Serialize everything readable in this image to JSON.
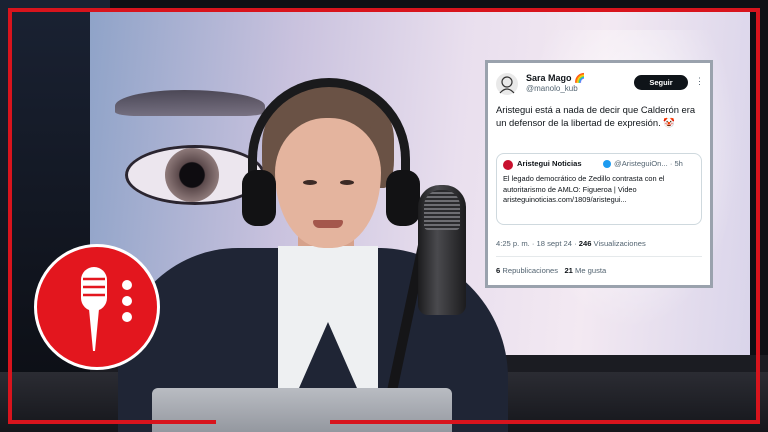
{
  "tweet": {
    "author_name": "Sara Mago 🌈",
    "author_handle": "@manolo_kub",
    "follow_label": "Seguir",
    "more_label": "⋮",
    "text": "Aristegui está a nada de decir que Calderón era un defensor de la libertad de expresión. 🤡",
    "quoted": {
      "name": "Aristegui Noticias",
      "handle": "@AristeguiOn... · 5h",
      "text": "El legado democrático de Zedillo contrasta con el autoritarismo de AMLO: Figueroa | Video aristeguinoticias.com/1809/aristegui..."
    },
    "time": "4:25 p. m. · 18 sept 24 ·",
    "views_count": "246",
    "views_label": "Visualizaciones",
    "reposts_count": "6",
    "reposts_label": "Republicaciones",
    "likes_count": "21",
    "likes_label": "Me gusta"
  },
  "colors": {
    "frame": "#d8141d",
    "logo_bg": "#e3161e",
    "follow_bg": "#0f1419"
  },
  "icons": {
    "logo": "microphone-icon",
    "verified": "verified-badge-icon"
  }
}
